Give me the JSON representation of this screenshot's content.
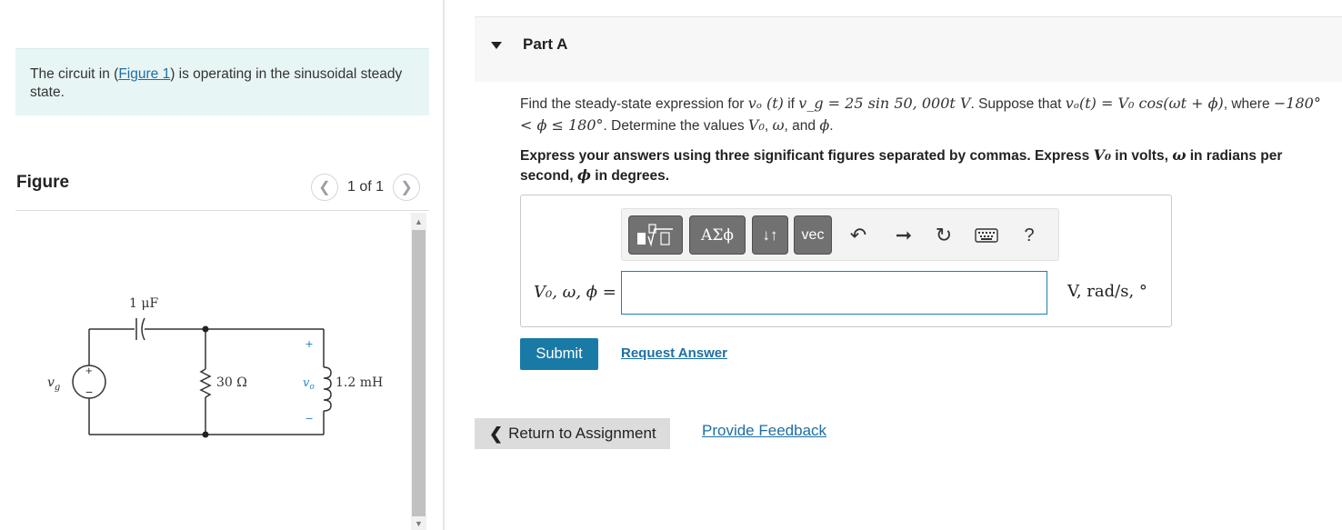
{
  "left": {
    "intro_prefix": "The circuit in (",
    "intro_link": "Figure 1",
    "intro_suffix": ") is operating in the sinusoidal steady state.",
    "figure_title": "Figure",
    "pager": {
      "prev_icon": "chevron-left-icon",
      "next_icon": "chevron-right-icon",
      "label": "1 of 1"
    },
    "circuit": {
      "capacitor": "1 μF",
      "resistor": "30 Ω",
      "inductor": "1.2 mH",
      "source": "v",
      "source_sub": "g",
      "output": "v",
      "output_sub": "o",
      "plus": "+",
      "minus": "−"
    }
  },
  "part": {
    "title": "Part A",
    "caret_icon": "caret-down-icon"
  },
  "question": {
    "t1": "Find the steady-state expression for ",
    "m1": "vₒ (t)",
    "t2": " if ",
    "m2": "v_g = 25 sin 50, 000t V",
    "t3": ". Suppose that ",
    "m3": "vₒ(t) = V₀ cos(ωt + ϕ)",
    "t4": ", where ",
    "m4": "−180° < ϕ ≤ 180°",
    "t5": ". Determine the values ",
    "m5": "V₀",
    "t6": ", ",
    "m6": "ω",
    "t7": ", and ",
    "m7": "ϕ",
    "t8": "."
  },
  "instruction": {
    "t1": "Express your answers using three significant figures separated by commas. Express ",
    "m1": "V₀",
    "t2": " in volts, ",
    "m2": "ω",
    "t3": " in radians per second, ",
    "m3": "ϕ",
    "t4": " in degrees."
  },
  "toolbar": {
    "templates_icon": "templates-icon",
    "greek_label": "ΑΣϕ",
    "arrows_label": "↓↑",
    "vec_label": "vec",
    "undo_icon": "undo-icon",
    "redo_icon": "redo-icon",
    "reset_icon": "reset-icon",
    "keyboard_icon": "keyboard-icon",
    "help_label": "?"
  },
  "answer": {
    "label": "V₀, ω, ϕ =",
    "value": "",
    "units": "V, rad/s, °"
  },
  "actions": {
    "submit": "Submit",
    "request": "Request Answer",
    "return": "Return to Assignment",
    "return_icon": "chevron-left-icon",
    "feedback": "Provide Feedback"
  }
}
